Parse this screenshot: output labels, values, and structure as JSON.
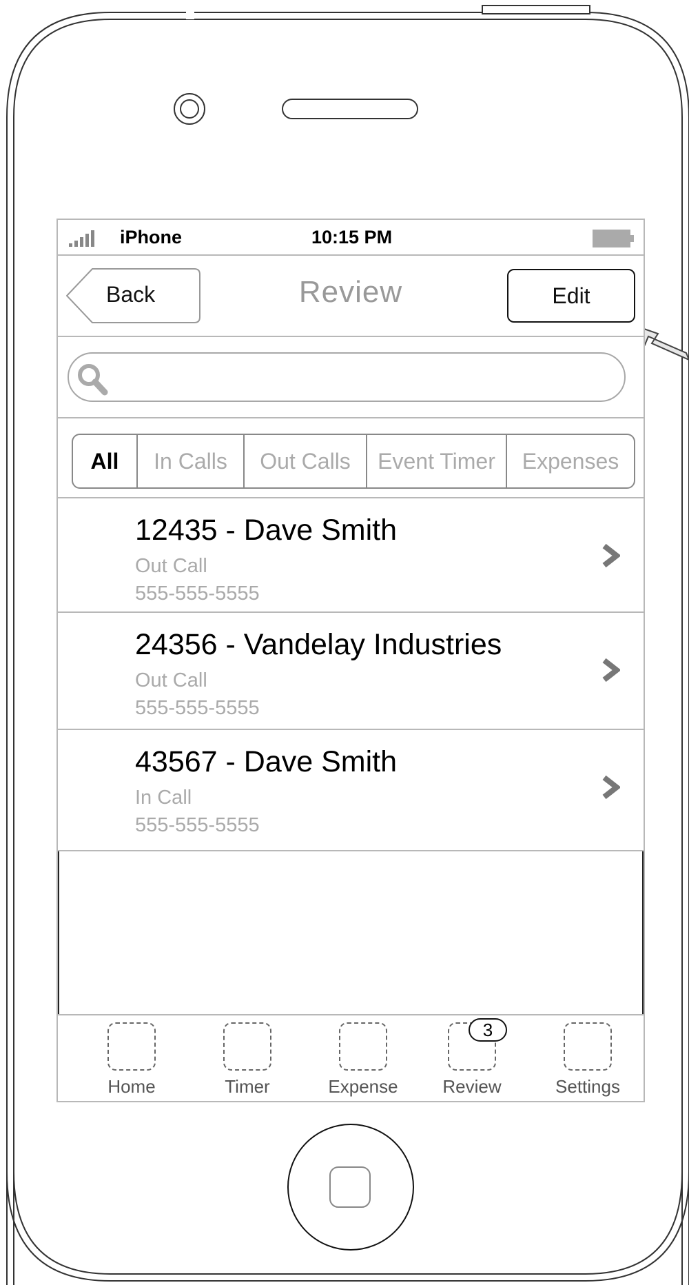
{
  "status_bar": {
    "carrier": "iPhone",
    "time": "10:15 PM"
  },
  "navbar": {
    "back_label": "Back",
    "title": "Review",
    "edit_label": "Edit"
  },
  "search": {
    "placeholder": "",
    "value": ""
  },
  "filters": {
    "segments": [
      {
        "label": "All",
        "selected": true
      },
      {
        "label": "In Calls",
        "selected": false
      },
      {
        "label": "Out Calls",
        "selected": false
      },
      {
        "label": "Event Timer",
        "selected": false
      },
      {
        "label": "Expenses",
        "selected": false
      }
    ]
  },
  "records": [
    {
      "title": "12435 - Dave Smith",
      "type": "Out Call",
      "phone": "555-555-5555"
    },
    {
      "title": "24356 - Vandelay Industries",
      "type": "Out Call",
      "phone": "555-555-5555"
    },
    {
      "title": "43567 - Dave Smith",
      "type": "In Call",
      "phone": "555-555-5555"
    }
  ],
  "tabbar": {
    "tabs": [
      {
        "label": "Home",
        "icon": "home-icon"
      },
      {
        "label": "Timer",
        "icon": "timer-icon"
      },
      {
        "label": "Expense",
        "icon": "expense-icon"
      },
      {
        "label": "Review",
        "icon": "review-icon",
        "badge": "3"
      },
      {
        "label": "Settings",
        "icon": "settings-icon"
      }
    ]
  },
  "colors": {
    "accent_text": "#000000",
    "muted_text": "#aaaaaa",
    "divider": "#b8b8b8"
  }
}
